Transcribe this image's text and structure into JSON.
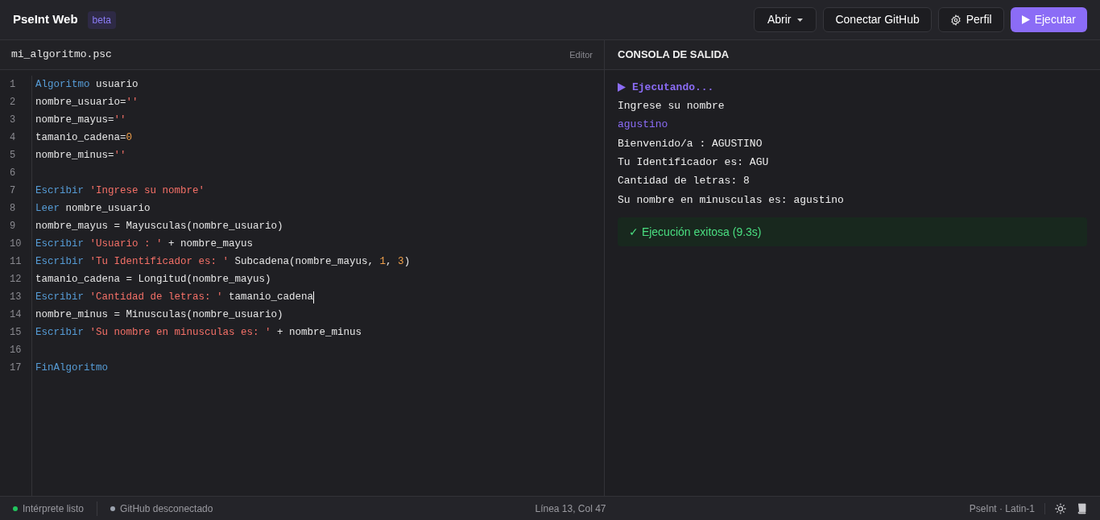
{
  "app": {
    "title": "PseInt Web",
    "badge": "beta"
  },
  "toolbar": [
    {
      "kind": "dropdown",
      "label": "Abrir"
    },
    {
      "kind": "plain",
      "label": "Conectar GitHub"
    },
    {
      "kind": "settings",
      "label": "Perfil"
    },
    {
      "kind": "run",
      "label": "Ejecutar"
    }
  ],
  "editor": {
    "file_name": "mi_algoritmo.psc",
    "tab_label": "Editor",
    "lines": [
      {
        "number": "1",
        "tokens": [
          {
            "kind": "keyword",
            "text": "Algoritmo"
          },
          {
            "kind": "plain",
            "text": " usuario"
          }
        ]
      },
      {
        "number": "2",
        "tokens": [
          {
            "kind": "plain",
            "text": "nombre_usuario="
          },
          {
            "kind": "string",
            "text": "''"
          }
        ]
      },
      {
        "number": "3",
        "tokens": [
          {
            "kind": "plain",
            "text": "nombre_mayus="
          },
          {
            "kind": "string",
            "text": "''"
          }
        ]
      },
      {
        "number": "4",
        "tokens": [
          {
            "kind": "plain",
            "text": "tamanio_cadena="
          },
          {
            "kind": "number",
            "text": "0"
          }
        ]
      },
      {
        "number": "5",
        "tokens": [
          {
            "kind": "plain",
            "text": "nombre_minus="
          },
          {
            "kind": "string",
            "text": "''"
          }
        ]
      },
      {
        "number": "6"
      },
      {
        "number": "7",
        "tokens": [
          {
            "kind": "keyword",
            "text": "Escribir "
          },
          {
            "kind": "string",
            "text": "'Ingrese su nombre'"
          }
        ]
      },
      {
        "number": "8",
        "tokens": [
          {
            "kind": "keyword",
            "text": "Leer"
          },
          {
            "kind": "plain",
            "text": " nombre_usuario"
          }
        ]
      },
      {
        "number": "9",
        "tokens": [
          {
            "kind": "plain",
            "text": "nombre_mayus = Mayusculas(nombre_usuario)"
          }
        ]
      },
      {
        "number": "10",
        "tokens": [
          {
            "kind": "keyword",
            "text": "Escribir "
          },
          {
            "kind": "string",
            "text": "'Usuario : '"
          },
          {
            "kind": "plain",
            "text": " + nombre_mayus"
          }
        ]
      },
      {
        "number": "11",
        "tokens": [
          {
            "kind": "keyword",
            "text": "Escribir "
          },
          {
            "kind": "string",
            "text": "'Tu Identificador es: '"
          },
          {
            "kind": "plain",
            "text": " Subcadena(nombre_mayus, "
          },
          {
            "kind": "number",
            "text": "1"
          },
          {
            "kind": "plain",
            "text": ", "
          },
          {
            "kind": "number",
            "text": "3"
          },
          {
            "kind": "plain",
            "text": ")"
          }
        ]
      },
      {
        "number": "12",
        "tokens": [
          {
            "kind": "plain",
            "text": "tamanio_cadena = Longitud(nombre_mayus)"
          }
        ]
      },
      {
        "number": "13",
        "cursor": true,
        "tokens": [
          {
            "kind": "keyword",
            "text": "Escribir "
          },
          {
            "kind": "string",
            "text": "'Cantidad de letras: '"
          },
          {
            "kind": "plain",
            "text": " tamanio_cadena"
          }
        ]
      },
      {
        "number": "14",
        "tokens": [
          {
            "kind": "plain",
            "text": "nombre_minus = Minusculas(nombre_usuario)"
          }
        ]
      },
      {
        "number": "15",
        "tokens": [
          {
            "kind": "keyword",
            "text": "Escribir "
          },
          {
            "kind": "string",
            "text": "'Su nombre en minusculas es: '"
          },
          {
            "kind": "plain",
            "text": " + nombre_minus"
          }
        ]
      },
      {
        "number": "16"
      },
      {
        "number": "17",
        "tokens": [
          {
            "kind": "keyword",
            "text": "FinAlgoritmo"
          }
        ]
      }
    ]
  },
  "console": {
    "title": "CONSOLA DE SALIDA",
    "lines": [
      {
        "kind": "status",
        "text": "Ejecutando..."
      },
      {
        "kind": "output",
        "text": "Ingrese su nombre"
      },
      {
        "kind": "input",
        "text": "agustino"
      },
      {
        "kind": "output",
        "text": "Bienvenido/a : AGUSTINO"
      },
      {
        "kind": "output",
        "text": "Tu Identificador es: AGU"
      },
      {
        "kind": "output",
        "text": "Cantidad de letras: 8"
      },
      {
        "kind": "output",
        "text": "Su nombre en minusculas es: agustino"
      }
    ],
    "result": "✓ Ejecución exitosa (9.3s)"
  },
  "status_bar": {
    "items": [
      {
        "text": "Intérprete listo",
        "color": "#22c55e"
      },
      {
        "text": "GitHub desconectado",
        "color": "#9ca3af"
      }
    ],
    "position": "Línea 13, Col 47",
    "language": "PseInt · Latin-1"
  }
}
